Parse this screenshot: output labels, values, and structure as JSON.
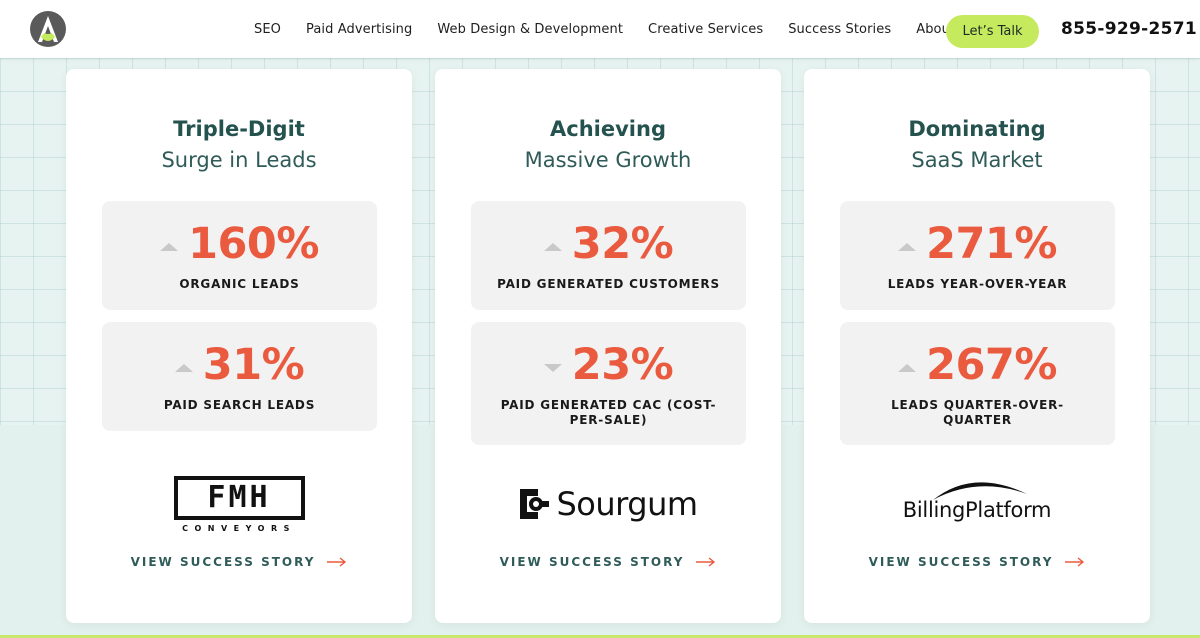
{
  "header": {
    "logo_icon": "triangle-a-logo",
    "nav": [
      "SEO",
      "Paid Advertising",
      "Web Design & Development",
      "Creative Services",
      "Success Stories",
      "About"
    ],
    "cta_label": "Let’s Talk",
    "phone": "855-929-2571"
  },
  "colors": {
    "accent_green": "#c6ea5d",
    "stat_red": "#ea5a3f",
    "title_teal": "#24524f",
    "background": "#e6f3f1"
  },
  "cards": [
    {
      "title_bold": "Triple-Digit",
      "title_light": "Surge in Leads",
      "stats": [
        {
          "direction": "up",
          "value": "160%",
          "label": "ORGANIC LEADS"
        },
        {
          "direction": "up",
          "value": "31%",
          "label": "PAID SEARCH LEADS"
        }
      ],
      "brand": {
        "name": "FMH",
        "sub": "CONVEYORS"
      },
      "link": "VIEW SUCCESS STORY"
    },
    {
      "title_bold": "Achieving",
      "title_light": "Massive Growth",
      "stats": [
        {
          "direction": "up",
          "value": "32%",
          "label": "PAID GENERATED CUSTOMERS"
        },
        {
          "direction": "down",
          "value": "23%",
          "label": "PAID GENERATED CAC (COST-PER-SALE)"
        }
      ],
      "brand": {
        "name": "Sourgum"
      },
      "link": "VIEW SUCCESS STORY"
    },
    {
      "title_bold": "Dominating",
      "title_light": "SaaS Market",
      "stats": [
        {
          "direction": "up",
          "value": "271%",
          "label": "LEADS YEAR-OVER-YEAR"
        },
        {
          "direction": "up",
          "value": "267%",
          "label": "LEADS QUARTER-OVER-QUARTER"
        }
      ],
      "brand": {
        "name": "BillingPlatform"
      },
      "link": "VIEW SUCCESS STORY"
    }
  ]
}
